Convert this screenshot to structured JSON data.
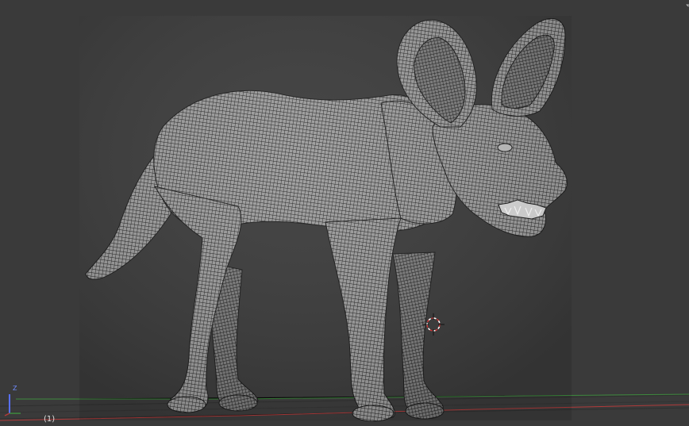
{
  "viewport": {
    "frame_label": "(1)",
    "axis_label": "Z",
    "background_color": "#3a3a3a",
    "mesh_color": "#8e8e8e",
    "wire_color": "#1c1c1c",
    "grid_x_color": "#b03a3a",
    "grid_y_color": "#3e8a3e",
    "cursor_color": "#cc3333",
    "z_axis_color": "#5870ff"
  },
  "icons": {
    "cursor": "3d-cursor-icon",
    "axis": "axis-gizmo-icon",
    "corner": "view-split-widget-icon"
  }
}
